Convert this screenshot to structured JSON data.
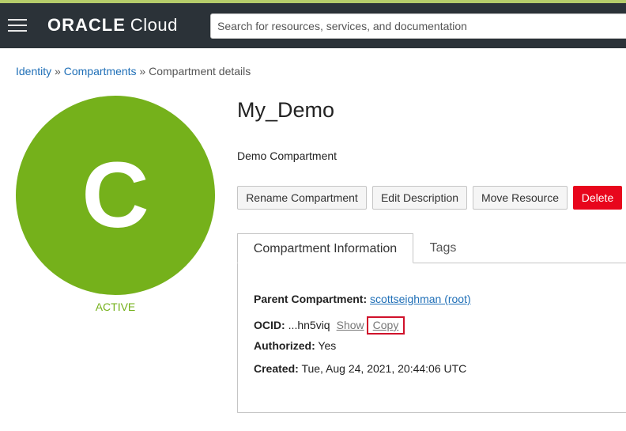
{
  "header": {
    "logo_brand": "ORACLE",
    "logo_product": "Cloud",
    "search_placeholder": "Search for resources, services, and documentation"
  },
  "breadcrumb": {
    "items": [
      "Identity",
      "Compartments"
    ],
    "separator": "»",
    "current": "Compartment details"
  },
  "avatar": {
    "letter": "C",
    "color": "#75b11b"
  },
  "status": "ACTIVE",
  "compartment": {
    "name": "My_Demo",
    "description": "Demo Compartment"
  },
  "actions": {
    "rename": "Rename Compartment",
    "edit": "Edit Description",
    "move": "Move Resource",
    "delete": "Delete"
  },
  "tabs": [
    "Compartment Information",
    "Tags"
  ],
  "info": {
    "parent_label": "Parent Compartment:",
    "parent_value": "scottseighman (root)",
    "ocid_label": "OCID:",
    "ocid_value": "...hn5viq",
    "show_label": "Show",
    "copy_label": "Copy",
    "authorized_label": "Authorized:",
    "authorized_value": "Yes",
    "created_label": "Created:",
    "created_value": "Tue, Aug 24, 2021, 20:44:06 UTC"
  },
  "colors": {
    "header_bg": "#2b3238",
    "link": "#1f6fb7",
    "delete": "#e8061c",
    "highlight_box": "#d0112b"
  }
}
